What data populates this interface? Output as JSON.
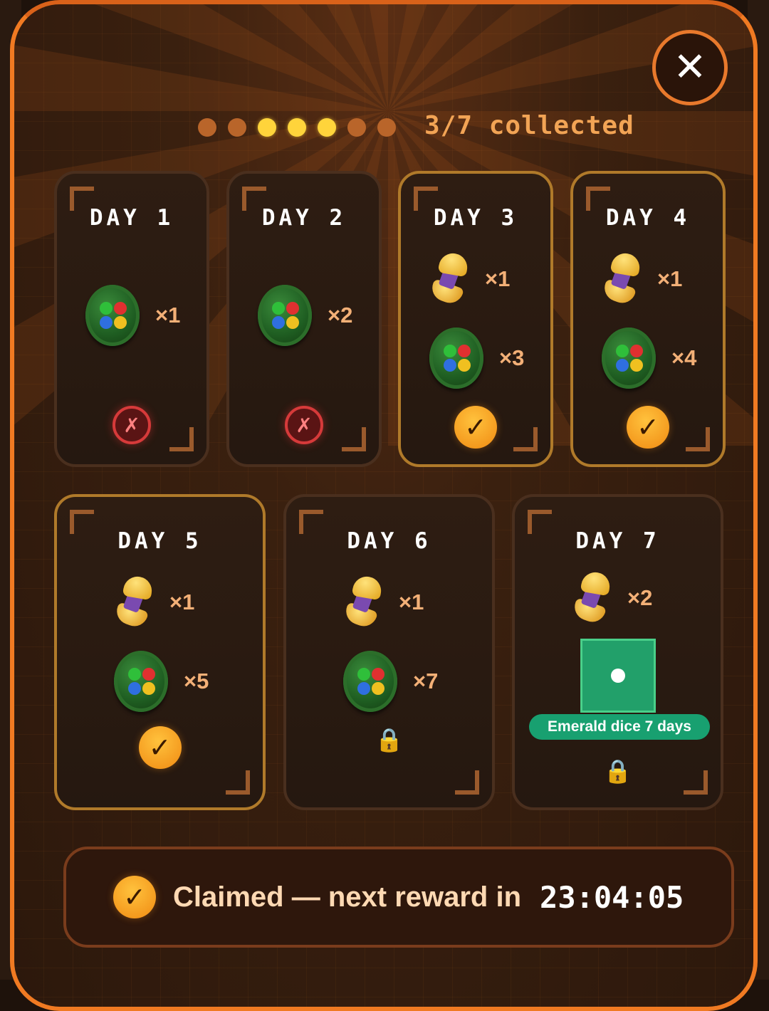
{
  "progress": {
    "label": "3/7 collected",
    "dots": [
      "todo",
      "todo",
      "done",
      "done",
      "done",
      "todo",
      "todo"
    ]
  },
  "close": {
    "icon": "close-icon",
    "glyph": "✕"
  },
  "days": [
    {
      "title": "DAY 1",
      "state": "missed",
      "rewards": [
        {
          "item": "coin",
          "qty": "×1"
        }
      ]
    },
    {
      "title": "DAY 2",
      "state": "missed",
      "rewards": [
        {
          "item": "coin",
          "qty": "×2"
        }
      ]
    },
    {
      "title": "DAY 3",
      "state": "claimed",
      "rewards": [
        {
          "item": "capsule",
          "qty": "×1"
        },
        {
          "item": "coin",
          "qty": "×3"
        }
      ]
    },
    {
      "title": "DAY 4",
      "state": "claimed",
      "rewards": [
        {
          "item": "capsule",
          "qty": "×1"
        },
        {
          "item": "coin",
          "qty": "×4"
        }
      ]
    },
    {
      "title": "DAY 5",
      "state": "claimed",
      "rewards": [
        {
          "item": "capsule",
          "qty": "×1"
        },
        {
          "item": "coin",
          "qty": "×5"
        }
      ]
    },
    {
      "title": "DAY 6",
      "state": "locked",
      "rewards": [
        {
          "item": "capsule",
          "qty": "×1"
        },
        {
          "item": "coin",
          "qty": "×7"
        }
      ]
    },
    {
      "title": "DAY 7",
      "state": "locked",
      "rewards": [
        {
          "item": "capsule",
          "qty": "×2"
        }
      ],
      "special": "Emerald dice 7 days"
    }
  ],
  "badges": {
    "check": "✓",
    "miss": "✗",
    "lock": "🔒"
  },
  "footer": {
    "text": "Claimed — next reward in",
    "timer": "23:04:05"
  },
  "colors": {
    "accent": "#f07a22",
    "check": "#f5a21c",
    "miss": "#d63a3a",
    "emerald": "#18a070"
  }
}
